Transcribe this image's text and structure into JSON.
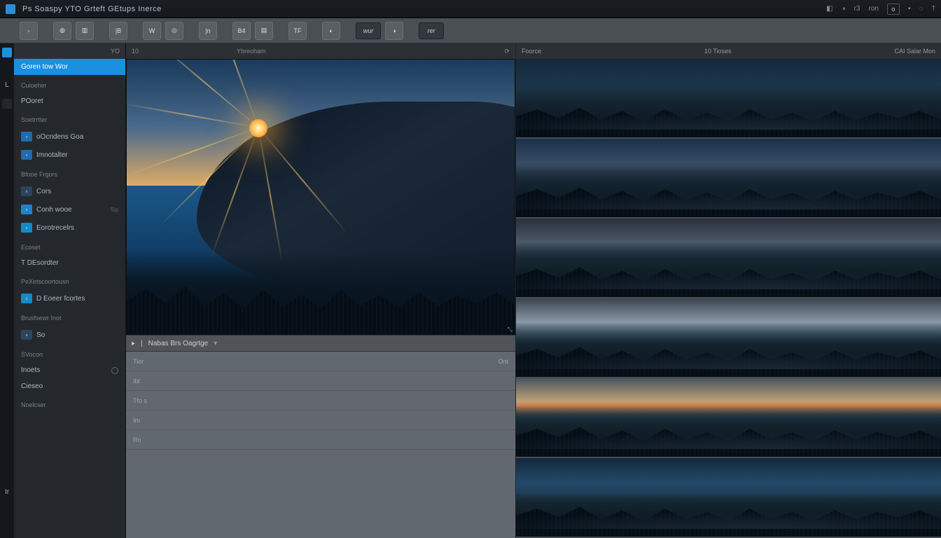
{
  "menubar": {
    "title": "Ps Soaspy YTO Grteft GEtups Inerce",
    "right": {
      "btn1": "r3",
      "btn2": "ron",
      "btn3": "o"
    }
  },
  "toolbar": {
    "btn_wur": "wur",
    "btn_rer": "rer"
  },
  "sidebar": {
    "head": "YO",
    "items": [
      {
        "label": "Goren tow Wor",
        "active": true
      },
      {
        "label": "Cuioeher",
        "section": true
      },
      {
        "label": "POoret"
      },
      {
        "label": "Soetrrtter",
        "section": true
      },
      {
        "label": "oOcndens Goa",
        "icon": true
      },
      {
        "label": "Imnotalter",
        "icon": true
      },
      {
        "label": "Bfooe Frgors",
        "section": true
      },
      {
        "label": "Cors",
        "icon": true,
        "ivariant": "c2"
      },
      {
        "label": "Conh wooe",
        "icon": true,
        "ivariant": "alt",
        "badge": "Sip"
      },
      {
        "label": "Eorotrecelrs",
        "icon": true,
        "ivariant": "c3"
      },
      {
        "label": "Ecoset",
        "section": true
      },
      {
        "label": "T DEsordter"
      },
      {
        "label": "PeXetscoortousn",
        "section": true
      },
      {
        "label": "D Eoeer fcortes",
        "icon": true,
        "ivariant": "c3"
      },
      {
        "label": "Brusfsewr Inot",
        "section": true
      },
      {
        "label": "So",
        "icon": true,
        "ivariant": "c2"
      },
      {
        "label": "SVocon",
        "section": true
      },
      {
        "label": "Inoets",
        "gear": true
      },
      {
        "label": "Cieseo"
      },
      {
        "label": "Noelcser",
        "section": true
      }
    ]
  },
  "center": {
    "head_left": "10",
    "head_right": "Ybreoham",
    "refresh": "⟳",
    "handle": "⤡",
    "propbar": {
      "icon": "▸",
      "label": "Nabas Brs Oagrtge",
      "caret": "▾"
    },
    "props": [
      {
        "label": "Tior",
        "right": "Ont"
      },
      {
        "label": "Ibl"
      },
      {
        "label": "Tfo s"
      },
      {
        "label": "Im"
      },
      {
        "label": "Rn"
      }
    ]
  },
  "rightp": {
    "head_left": "Foorce",
    "head_mid": "10  Tioses",
    "head_right": "CAI  Salar Mon"
  }
}
